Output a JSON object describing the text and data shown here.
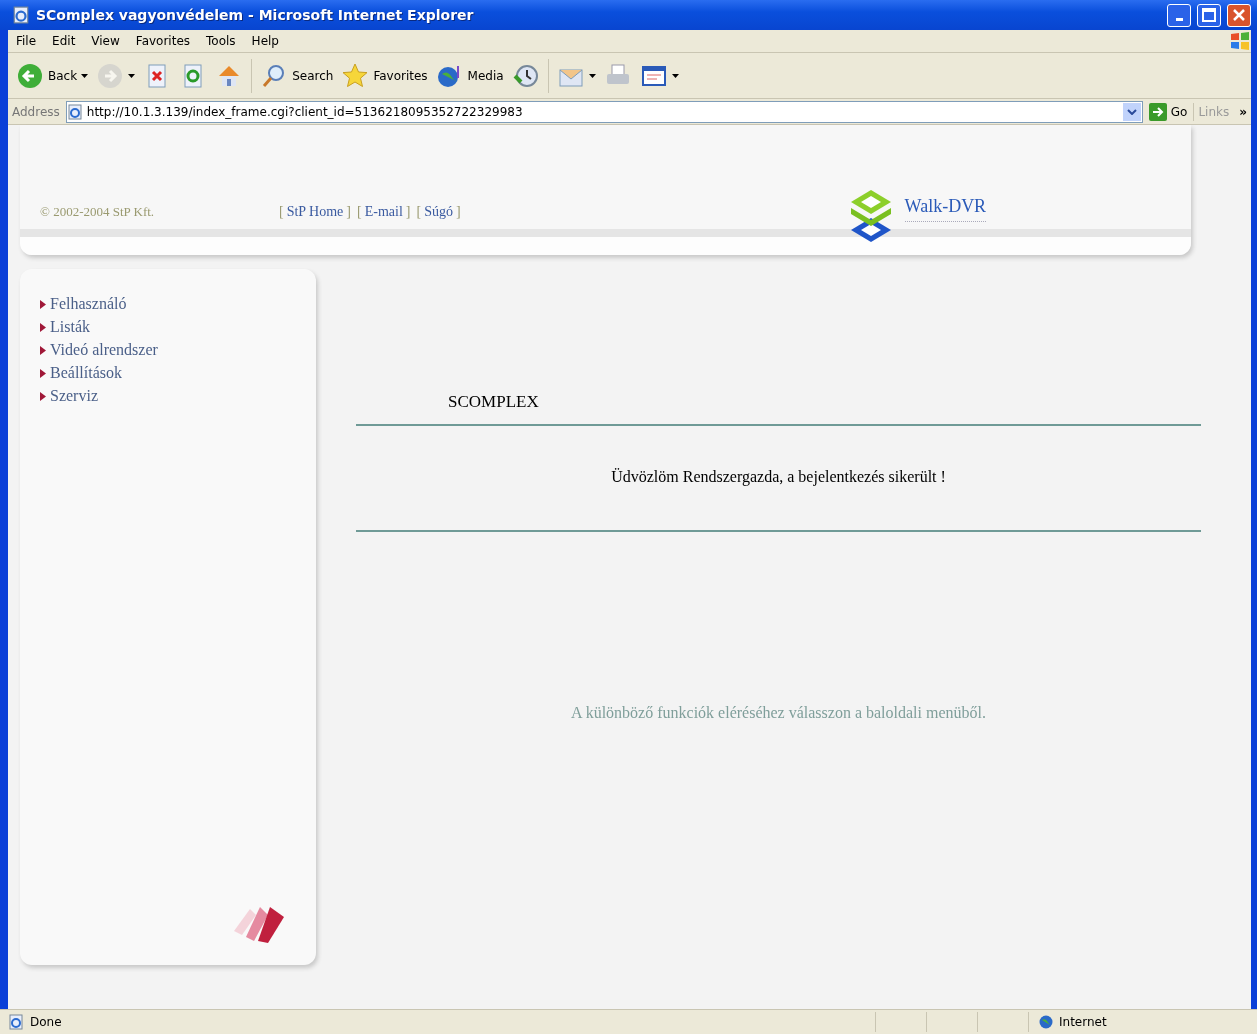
{
  "window": {
    "title": "SComplex vagyonvédelem - Microsoft Internet Explorer"
  },
  "menu_bar": [
    "File",
    "Edit",
    "View",
    "Favorites",
    "Tools",
    "Help"
  ],
  "toolbar": [
    {
      "kind": "back",
      "label": "Back",
      "dropdown": true,
      "disabled": false
    },
    {
      "kind": "forward",
      "dropdown": true,
      "disabled": true
    },
    {
      "kind": "stop",
      "dropdown": false,
      "disabled": false
    },
    {
      "kind": "refresh",
      "dropdown": false,
      "disabled": false
    },
    {
      "kind": "home",
      "dropdown": false,
      "disabled": false
    },
    {
      "kind": "search",
      "label": "Search",
      "dropdown": false,
      "disabled": false
    },
    {
      "kind": "favorites",
      "label": "Favorites",
      "dropdown": false,
      "disabled": false
    },
    {
      "kind": "media",
      "label": "Media",
      "dropdown": false,
      "disabled": false
    },
    {
      "kind": "history",
      "dropdown": false,
      "disabled": false
    },
    {
      "kind": "mail",
      "dropdown": true,
      "disabled": false
    },
    {
      "kind": "print",
      "dropdown": false,
      "disabled": false
    },
    {
      "kind": "edit",
      "dropdown": true,
      "disabled": false
    }
  ],
  "address_bar": {
    "label": "Address",
    "value": "http://10.1.3.139/index_frame.cgi?client_id=5136218095352722329983",
    "go": "Go",
    "links": "Links",
    "more": "»"
  },
  "header": {
    "copyright": "© 2002-2004 StP Kft.",
    "links": [
      {
        "open": "[",
        "label": "StP Home",
        "close": "]"
      },
      {
        "open": "[",
        "label": "E-mail",
        "close": "]"
      },
      {
        "open": "[",
        "label": "Súgó",
        "close": "]"
      }
    ],
    "brand": "Walk-DVR"
  },
  "sidebar": {
    "items": [
      "Felhasználó",
      "Listák",
      "Videó alrendszer",
      "Beállítások",
      "Szerviz"
    ]
  },
  "main": {
    "heading": "SCOMPLEX",
    "message": "Üdvözlöm Rendszergazda, a bejelentkezés sikerült !",
    "hint": "A különböző funkciók eléréséhez válasszon a baloldali menüből."
  },
  "status_bar": {
    "text": "Done",
    "zone": "Internet"
  }
}
